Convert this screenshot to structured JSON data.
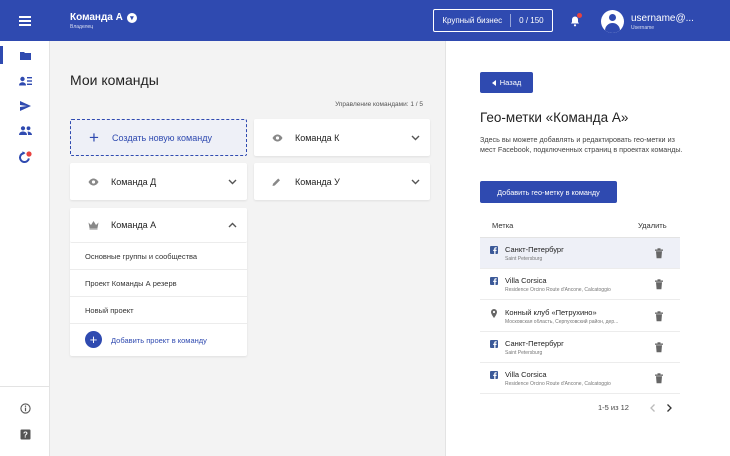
{
  "header": {
    "team_name": "Команда А",
    "team_role": "Владелец",
    "plan_name": "Крупный бизнес",
    "plan_usage": "0 / 150",
    "username": "username@...",
    "user_sub": "Username"
  },
  "colors": {
    "primary": "#2f4ab0",
    "bell_dot": "#e8423f",
    "highlight": "#eef0f7"
  },
  "sidebar": {
    "items": [
      {
        "icon": "folder-icon",
        "active": true
      },
      {
        "icon": "user-list-icon",
        "active": false
      },
      {
        "icon": "send-icon",
        "active": false
      },
      {
        "icon": "people-icon",
        "active": false
      },
      {
        "icon": "refresh-badge-icon",
        "active": false
      }
    ],
    "bottom": [
      {
        "icon": "info-icon"
      },
      {
        "icon": "help-icon"
      }
    ]
  },
  "main": {
    "title": "Мои команды",
    "manage_label": "Управление командами: 1 / 5",
    "create_label": "Создать новую команду",
    "teams": [
      {
        "name": "Команда К",
        "icon": "eye-icon"
      },
      {
        "name": "Команда Д",
        "icon": "eye-icon"
      },
      {
        "name": "Команда У",
        "icon": "pencil-icon"
      }
    ],
    "expanded_team": {
      "name": "Команда А",
      "icon": "crown-icon",
      "projects": [
        "Основные группы и сообщества",
        "Проект Команды А резерв",
        "Новый проект"
      ],
      "add_project_label": "Добавить проект в команду"
    }
  },
  "panel": {
    "back_label": "Назад",
    "title": "Гео-метки «Команда А»",
    "description": "Здесь вы можете добавлять и редактировать гео-метки из мест Facebook, подключенных страниц в проектах команды.",
    "add_button": "Добавить гео-метку в команду",
    "col_tag": "Метка",
    "col_delete": "Удалить",
    "rows": [
      {
        "name": "Санкт-Петербург",
        "sub": "Saint Petersburg",
        "icon": "facebook-icon",
        "highlighted": true
      },
      {
        "name": "Villa Corsica",
        "sub": "Residence Orcino Route d'Ancone, Calcatoggio",
        "icon": "facebook-icon",
        "highlighted": false
      },
      {
        "name": "Конный клуб «Петрухино»",
        "sub": "Московская область, Серпуховский район, дер...",
        "icon": "map-pin-icon",
        "highlighted": false
      },
      {
        "name": "Санкт-Петербург",
        "sub": "Saint Petersburg",
        "icon": "facebook-icon",
        "highlighted": false
      },
      {
        "name": "Villa Corsica",
        "sub": "Residence Orcino Route d'Ancone, Calcatoggio",
        "icon": "facebook-icon",
        "highlighted": false
      }
    ],
    "pagination": "1-5 из 12"
  }
}
